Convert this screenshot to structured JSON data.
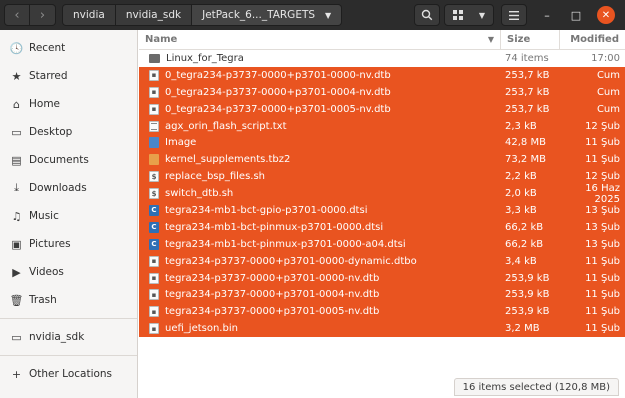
{
  "header": {
    "back_icon": "‹",
    "forward_icon": "›",
    "breadcrumbs": [
      "nvidia",
      "nvidia_sdk",
      "JetPack_6..._TARGETS"
    ],
    "search_icon": "search-icon",
    "view_icon": "grid-view-icon",
    "menu_icon": "hamburger-menu-icon",
    "minimize": "–",
    "maximize": "□",
    "close": "✕",
    "accent": "#e95420"
  },
  "sidebar": {
    "items": [
      {
        "label": "Recent",
        "icon": "🕓"
      },
      {
        "label": "Starred",
        "icon": "★"
      },
      {
        "label": "Home",
        "icon": "⌂"
      },
      {
        "label": "Desktop",
        "icon": "▭"
      },
      {
        "label": "Documents",
        "icon": "▤"
      },
      {
        "label": "Downloads",
        "icon": "⤓"
      },
      {
        "label": "Music",
        "icon": "♫"
      },
      {
        "label": "Pictures",
        "icon": "▣"
      },
      {
        "label": "Videos",
        "icon": "▶"
      },
      {
        "label": "Trash",
        "icon": "🗑"
      }
    ],
    "mounts": [
      {
        "label": "nvidia_sdk",
        "icon": "▭"
      }
    ],
    "other": {
      "label": "Other Locations",
      "icon": "+"
    }
  },
  "columns": {
    "name": "Name",
    "size": "Size",
    "modified": "Modified"
  },
  "files": [
    {
      "name": "Linux_for_Tegra",
      "size": "74 items",
      "modified": "17:00",
      "type": "folder",
      "selected": false
    },
    {
      "name": "0_tegra234-p3737-0000+p3701-0000-nv.dtb",
      "size": "253,7 kB",
      "modified": "Cum",
      "type": "bin",
      "selected": true
    },
    {
      "name": "0_tegra234-p3737-0000+p3701-0004-nv.dtb",
      "size": "253,7 kB",
      "modified": "Cum",
      "type": "bin",
      "selected": true
    },
    {
      "name": "0_tegra234-p3737-0000+p3701-0005-nv.dtb",
      "size": "253,7 kB",
      "modified": "Cum",
      "type": "bin",
      "selected": true
    },
    {
      "name": "agx_orin_flash_script.txt",
      "size": "2,3 kB",
      "modified": "12 Şub",
      "type": "text",
      "selected": true
    },
    {
      "name": "Image",
      "size": "42,8 MB",
      "modified": "11 Şub",
      "type": "image",
      "selected": true
    },
    {
      "name": "kernel_supplements.tbz2",
      "size": "73,2 MB",
      "modified": "11 Şub",
      "type": "archive",
      "selected": true
    },
    {
      "name": "replace_bsp_files.sh",
      "size": "2,2 kB",
      "modified": "12 Şub",
      "type": "script",
      "selected": true
    },
    {
      "name": "switch_dtb.sh",
      "size": "2,0 kB",
      "modified": "16 Haz 2025",
      "type": "script",
      "selected": true
    },
    {
      "name": "tegra234-mb1-bct-gpio-p3701-0000.dtsi",
      "size": "3,3 kB",
      "modified": "13 Şub",
      "type": "csrc",
      "selected": true
    },
    {
      "name": "tegra234-mb1-bct-pinmux-p3701-0000.dtsi",
      "size": "66,2 kB",
      "modified": "13 Şub",
      "type": "csrc",
      "selected": true
    },
    {
      "name": "tegra234-mb1-bct-pinmux-p3701-0000-a04.dtsi",
      "size": "66,2 kB",
      "modified": "13 Şub",
      "type": "csrc",
      "selected": true
    },
    {
      "name": "tegra234-p3737-0000+p3701-0000-dynamic.dtbo",
      "size": "3,4 kB",
      "modified": "11 Şub",
      "type": "bin",
      "selected": true
    },
    {
      "name": "tegra234-p3737-0000+p3701-0000-nv.dtb",
      "size": "253,9 kB",
      "modified": "11 Şub",
      "type": "bin",
      "selected": true
    },
    {
      "name": "tegra234-p3737-0000+p3701-0004-nv.dtb",
      "size": "253,9 kB",
      "modified": "11 Şub",
      "type": "bin",
      "selected": true
    },
    {
      "name": "tegra234-p3737-0000+p3701-0005-nv.dtb",
      "size": "253,9 kB",
      "modified": "11 Şub",
      "type": "bin",
      "selected": true
    },
    {
      "name": "uefi_jetson.bin",
      "size": "3,2 MB",
      "modified": "11 Şub",
      "type": "bin",
      "selected": true
    }
  ],
  "status": "16 items selected (120,8 MB)"
}
